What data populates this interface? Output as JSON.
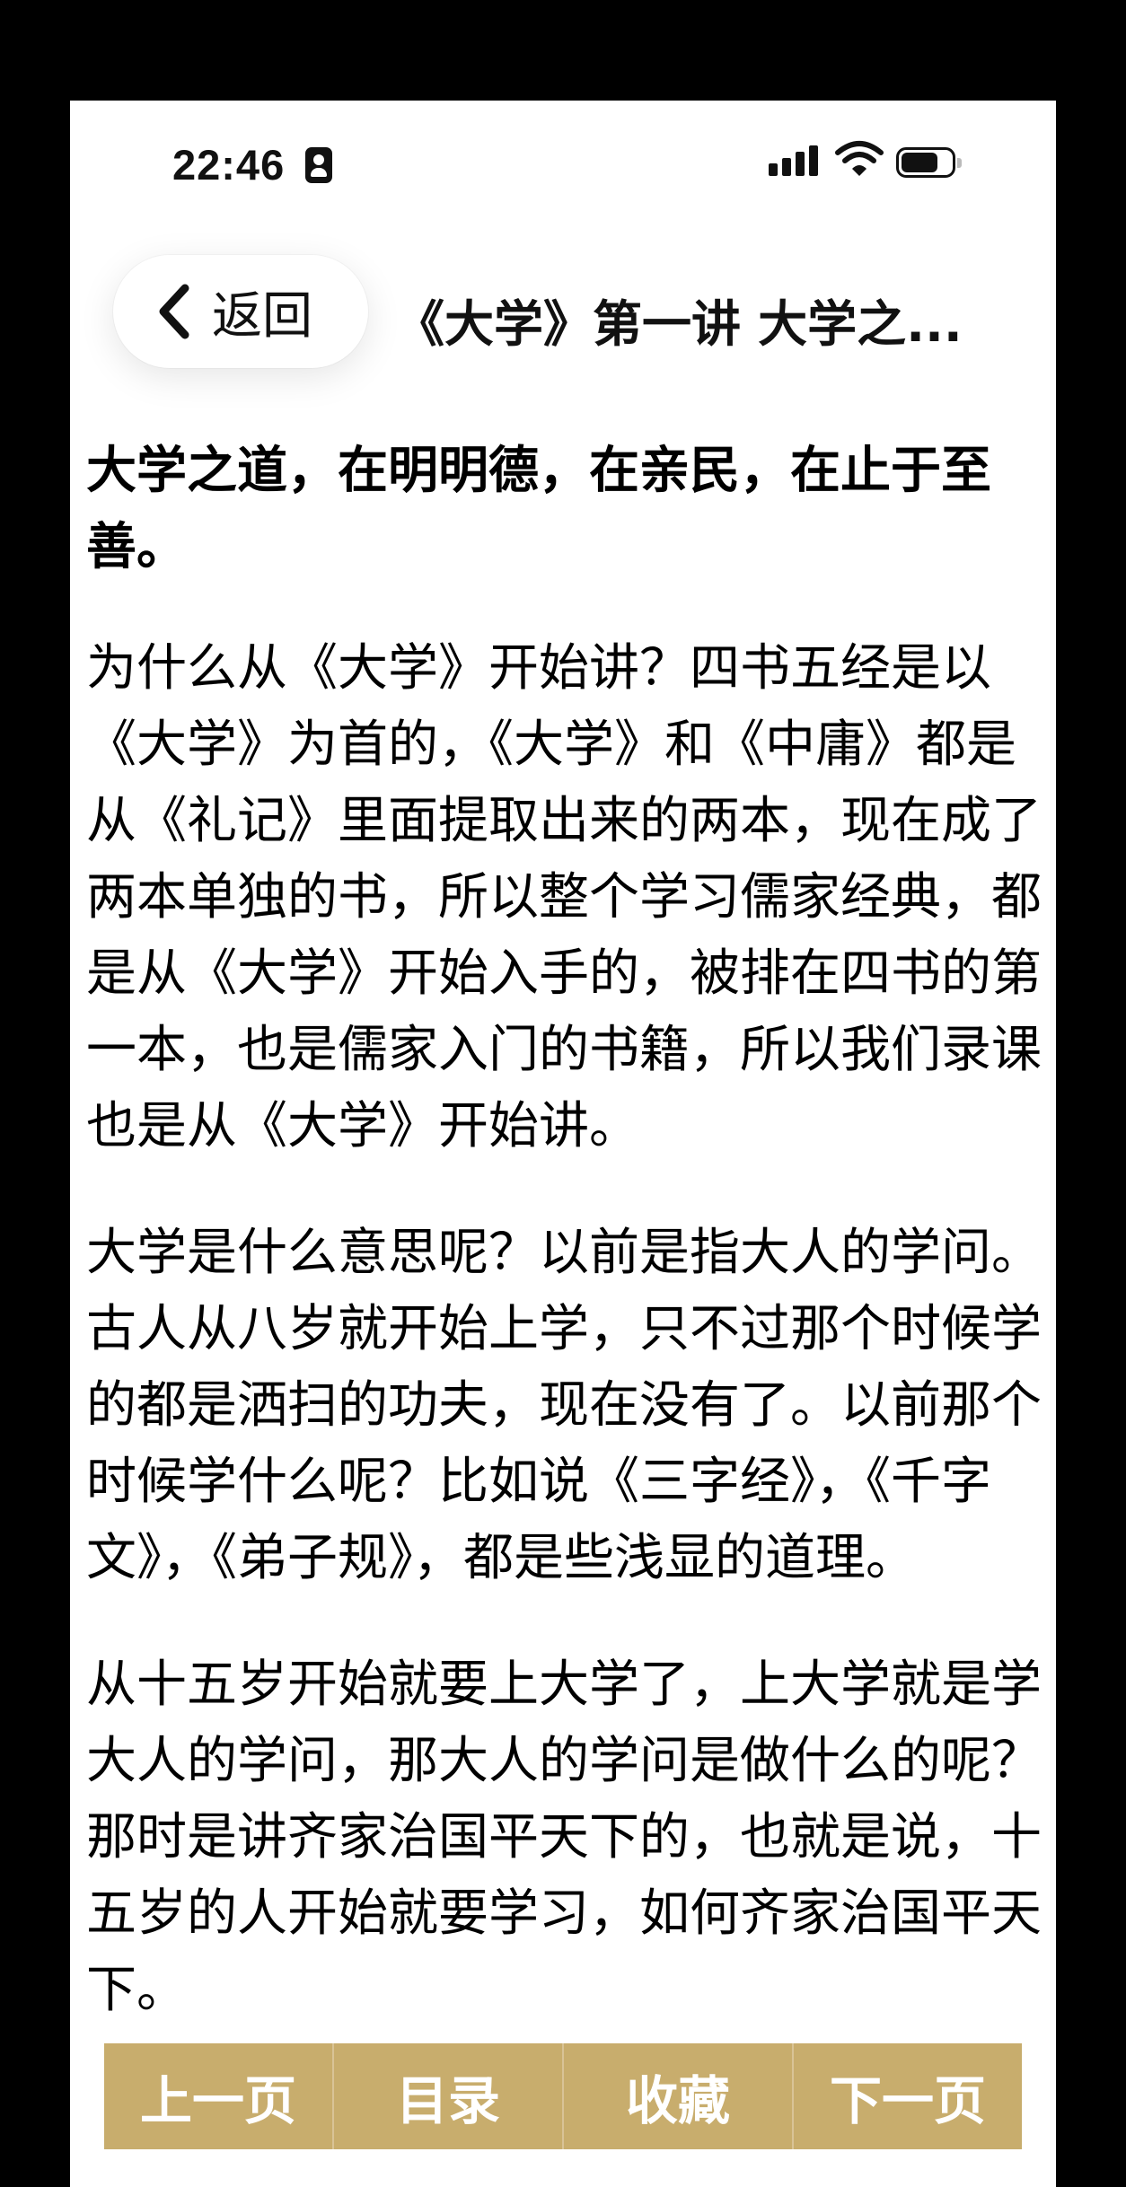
{
  "status_bar": {
    "time": "22:46"
  },
  "nav": {
    "back_label": "返回",
    "title": "《大学》第一讲 大学之..."
  },
  "article": {
    "heading": "大学之道，在明明德，在亲民，在止于至善。",
    "paragraphs": [
      "为什么从《大学》开始讲？四书五经是以《大学》为首的，《大学》和《中庸》都是从《礼记》里面提取出来的两本，现在成了两本单独的书，所以整个学习儒家经典，都是从《大学》开始入手的，被排在四书的第一本，也是儒家入门的书籍，所以我们录课也是从《大学》开始讲。",
      "大学是什么意思呢？以前是指大人的学问。古人从八岁就开始上学，只不过那个时候学的都是洒扫的功夫，现在没有了。以前那个时候学什么呢？比如说《三字经》，《千字文》，《弟子规》，都是些浅显的道理。",
      "从十五岁开始就要上大学了，上大学就是学大人的学问，那大人的学问是做什么的呢？那时是讲齐家治国平天下的，也就是说，十五岁的人开始就要学习，如何齐家治国平天下。"
    ]
  },
  "bottom_bar": {
    "prev": "上一页",
    "toc": "目录",
    "favorite": "收藏",
    "next": "下一页",
    "color": "#c8ad6d"
  },
  "icons": [
    "person-id-icon",
    "signal-icon",
    "wifi-icon",
    "battery-icon",
    "chevron-left-icon"
  ]
}
